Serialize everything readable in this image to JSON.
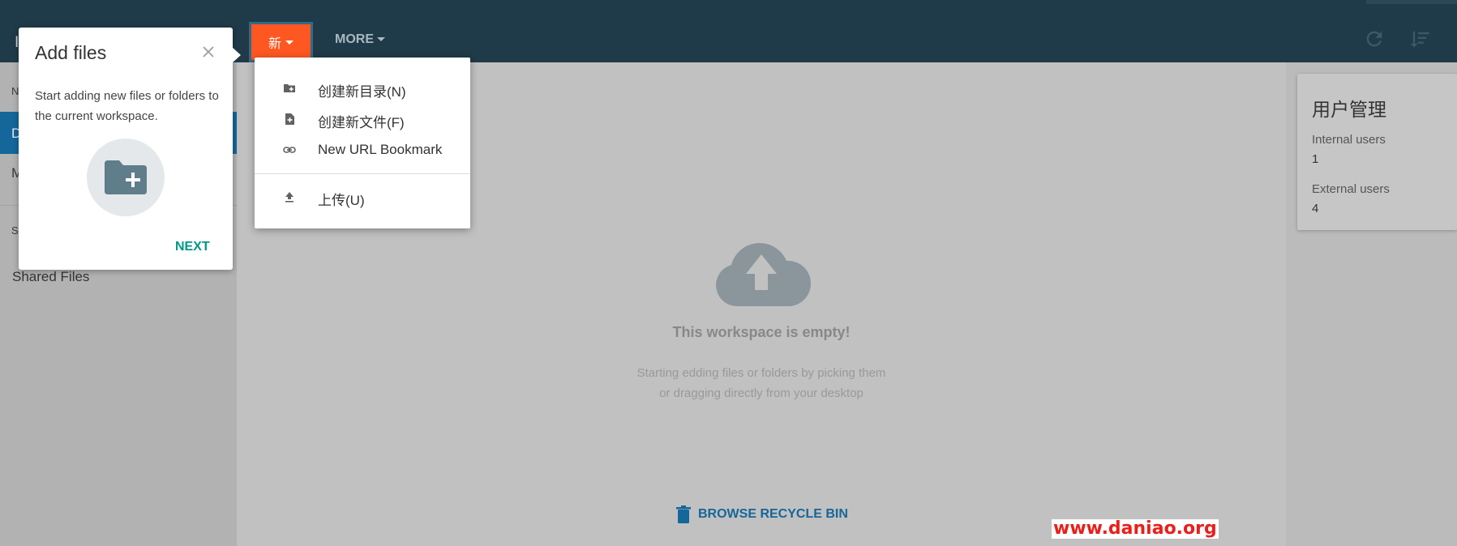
{
  "toolbar": {
    "new_label": "新",
    "more_label": "MORE",
    "refresh_icon": "refresh-icon",
    "sort_icon": "sort-icon"
  },
  "sidebar": {
    "letters": [
      "I",
      "N",
      "D",
      "M",
      "S"
    ],
    "items": [
      {
        "label": "Shared Files"
      }
    ]
  },
  "tour": {
    "title": "Add files",
    "text": "Start adding new files or folders to the current workspace.",
    "next_label": "NEXT",
    "icon": "create-folder-icon"
  },
  "new_menu": {
    "items": [
      {
        "label": "创建新目录(N)",
        "icon": "create-folder-icon"
      },
      {
        "label": "创建新文件(F)",
        "icon": "create-file-icon"
      },
      {
        "label": "New URL Bookmark",
        "icon": "link-icon"
      },
      {
        "label": "上传(U)",
        "icon": "upload-icon"
      }
    ]
  },
  "empty_state": {
    "title": "This workspace is empty!",
    "line1": "Starting edding files or folders by picking them",
    "line2": "or dragging directly from your desktop",
    "icon": "cloud-upload-icon"
  },
  "recycle": {
    "label": "BROWSE RECYCLE BIN",
    "icon": "trash-icon"
  },
  "user_management": {
    "title": "用户管理",
    "internal_label": "Internal users",
    "internal_value": "1",
    "external_label": "External users",
    "external_value": "4"
  },
  "watermark": "www.daniao.org",
  "colors": {
    "topbar": "#1f3a48",
    "accent_new": "#ff5722",
    "teal_next": "#009688",
    "link_blue": "#15669a",
    "watermark": "#e8201c"
  }
}
